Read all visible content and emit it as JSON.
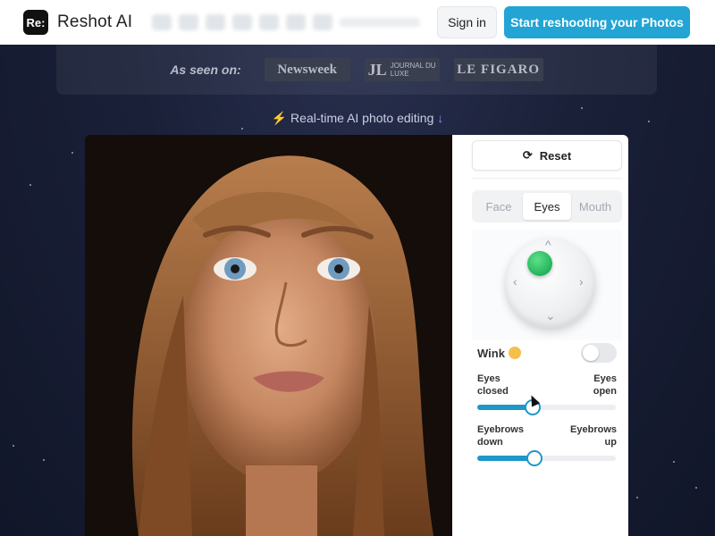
{
  "header": {
    "logo_text": "Re:",
    "brand": "Reshot AI",
    "signin_label": "Sign in",
    "cta_label": "Start reshooting your Photos"
  },
  "press": {
    "label": "As seen on:",
    "logos": [
      "Newsweek",
      "JOURNAL DU LUXE",
      "LE FIGARO"
    ]
  },
  "tagline": "Real-time AI photo editing",
  "editor": {
    "reset_label": "Reset",
    "tabs": [
      {
        "label": "Face",
        "active": false
      },
      {
        "label": "Eyes",
        "active": true
      },
      {
        "label": "Mouth",
        "active": false
      }
    ],
    "wink_label": "Wink",
    "wink_on": false,
    "sliders": [
      {
        "left": "Eyes closed",
        "right": "Eyes open",
        "value": 0.4
      },
      {
        "left": "Eyebrows down",
        "right": "Eyebrows up",
        "value": 0.41
      }
    ]
  },
  "colors": {
    "accent": "#22a4d4",
    "slider": "#1f97c7",
    "knob": "#22b45a"
  }
}
